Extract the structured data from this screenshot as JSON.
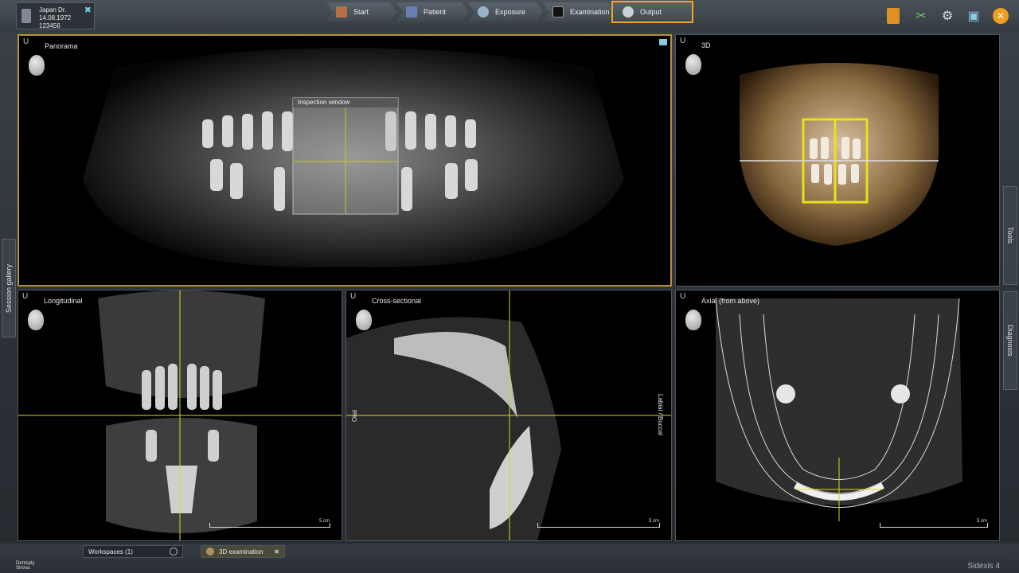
{
  "patient": {
    "name": "Japan Dr.",
    "dob": "14.08.1972",
    "id": "123456"
  },
  "workflow": [
    {
      "label": "Start",
      "icon": "home-icon"
    },
    {
      "label": "Patient",
      "icon": "patient-icon"
    },
    {
      "label": "Exposure",
      "icon": "exposure-icon"
    },
    {
      "label": "Examination",
      "icon": "examination-icon"
    },
    {
      "label": "Output",
      "icon": "output-icon",
      "active": true
    }
  ],
  "toolbar_icons": [
    "document-icon",
    "tools-icon",
    "gear-icon",
    "window-icon",
    "close-icon"
  ],
  "views": {
    "panorama": {
      "label": "Panorama",
      "orientation": "U",
      "inspection_window": "Inspection window"
    },
    "three_d": {
      "label": "3D",
      "orientation": "U"
    },
    "longitudinal": {
      "label": "Longitudinal",
      "orientation": "U",
      "scale": "5 cm"
    },
    "cross_sectional": {
      "label": "Cross-sectional",
      "orientation": "U",
      "scale": "5 cm",
      "oral": "Oral",
      "labial": "Labial / Buccal"
    },
    "axial": {
      "label": "Axial (from above)",
      "orientation": "U",
      "scale": "5 cm"
    }
  },
  "side_tabs": {
    "left": "Session gallery",
    "right_top": "Tools",
    "right_bottom": "Diagnosis"
  },
  "bottom": {
    "workspaces": "Workspaces (1)",
    "tab": "3D examination",
    "brand_1": "Dentsply",
    "brand_2": "Sirona",
    "product": "Sidexis 4"
  },
  "colors": {
    "active_outline": "#f0a820",
    "crosshair": "#d8d820",
    "selected_border": "#b8903a"
  }
}
